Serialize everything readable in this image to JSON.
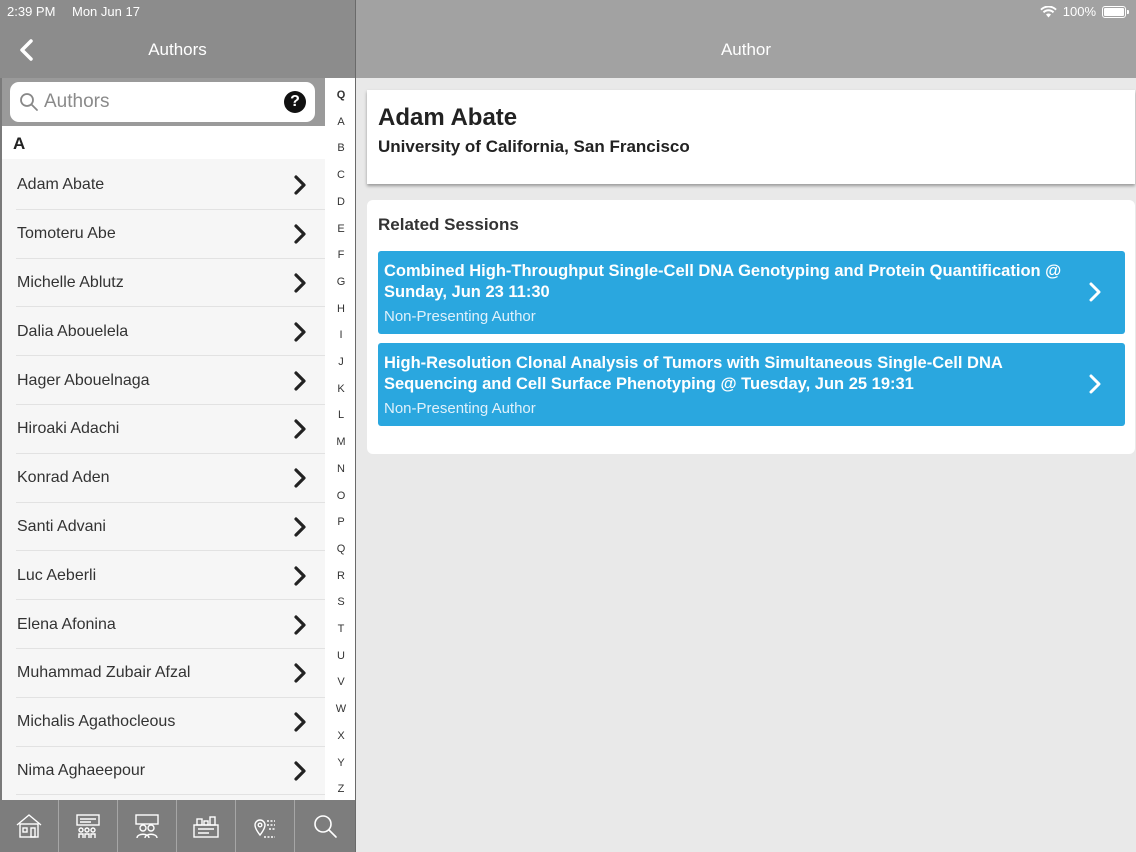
{
  "status_bar": {
    "time": "2:39 PM",
    "date": "Mon Jun 17",
    "battery": "100%"
  },
  "left_nav": {
    "title": "Authors",
    "back_icon": "chevron-left-icon"
  },
  "right_nav": {
    "title": "Author"
  },
  "search": {
    "placeholder": "Authors",
    "value": ""
  },
  "section_letter": "A",
  "authors": [
    "Adam Abate",
    "Tomoteru Abe",
    "Michelle Ablutz",
    "Dalia Abouelela",
    "Hager Abouelnaga",
    "Hiroaki Adachi",
    "Konrad Aden",
    "Santi Advani",
    "Luc Aeberli",
    "Elena Afonina",
    "Muhammad Zubair Afzal",
    "Michalis Agathocleous",
    "Nima Aghaeepour"
  ],
  "index_letters": [
    "Q",
    "A",
    "B",
    "C",
    "D",
    "E",
    "F",
    "G",
    "H",
    "I",
    "J",
    "K",
    "L",
    "M",
    "N",
    "O",
    "P",
    "Q",
    "R",
    "S",
    "T",
    "U",
    "V",
    "W",
    "X",
    "Y",
    "Z"
  ],
  "tabs": [
    "home-icon",
    "program-icon",
    "people-icon",
    "exhibits-icon",
    "map-icon",
    "search-icon"
  ],
  "author_detail": {
    "name": "Adam Abate",
    "institution": "University of California, San Francisco"
  },
  "related": {
    "heading": "Related Sessions",
    "sessions": [
      {
        "title": "Combined High-Throughput Single-Cell DNA Genotyping and Protein Quantification @ Sunday, Jun 23 11:30",
        "role": "Non-Presenting Author"
      },
      {
        "title": "High-Resolution Clonal Analysis of Tumors with Simultaneous Single-Cell DNA Sequencing and Cell Surface Phenotyping @ Tuesday, Jun 25 19:31",
        "role": "Non-Presenting Author"
      }
    ]
  },
  "colors": {
    "nav_left": "#8c8c8c",
    "nav_right": "#a2a2a2",
    "session_blue": "#2aa7df"
  }
}
